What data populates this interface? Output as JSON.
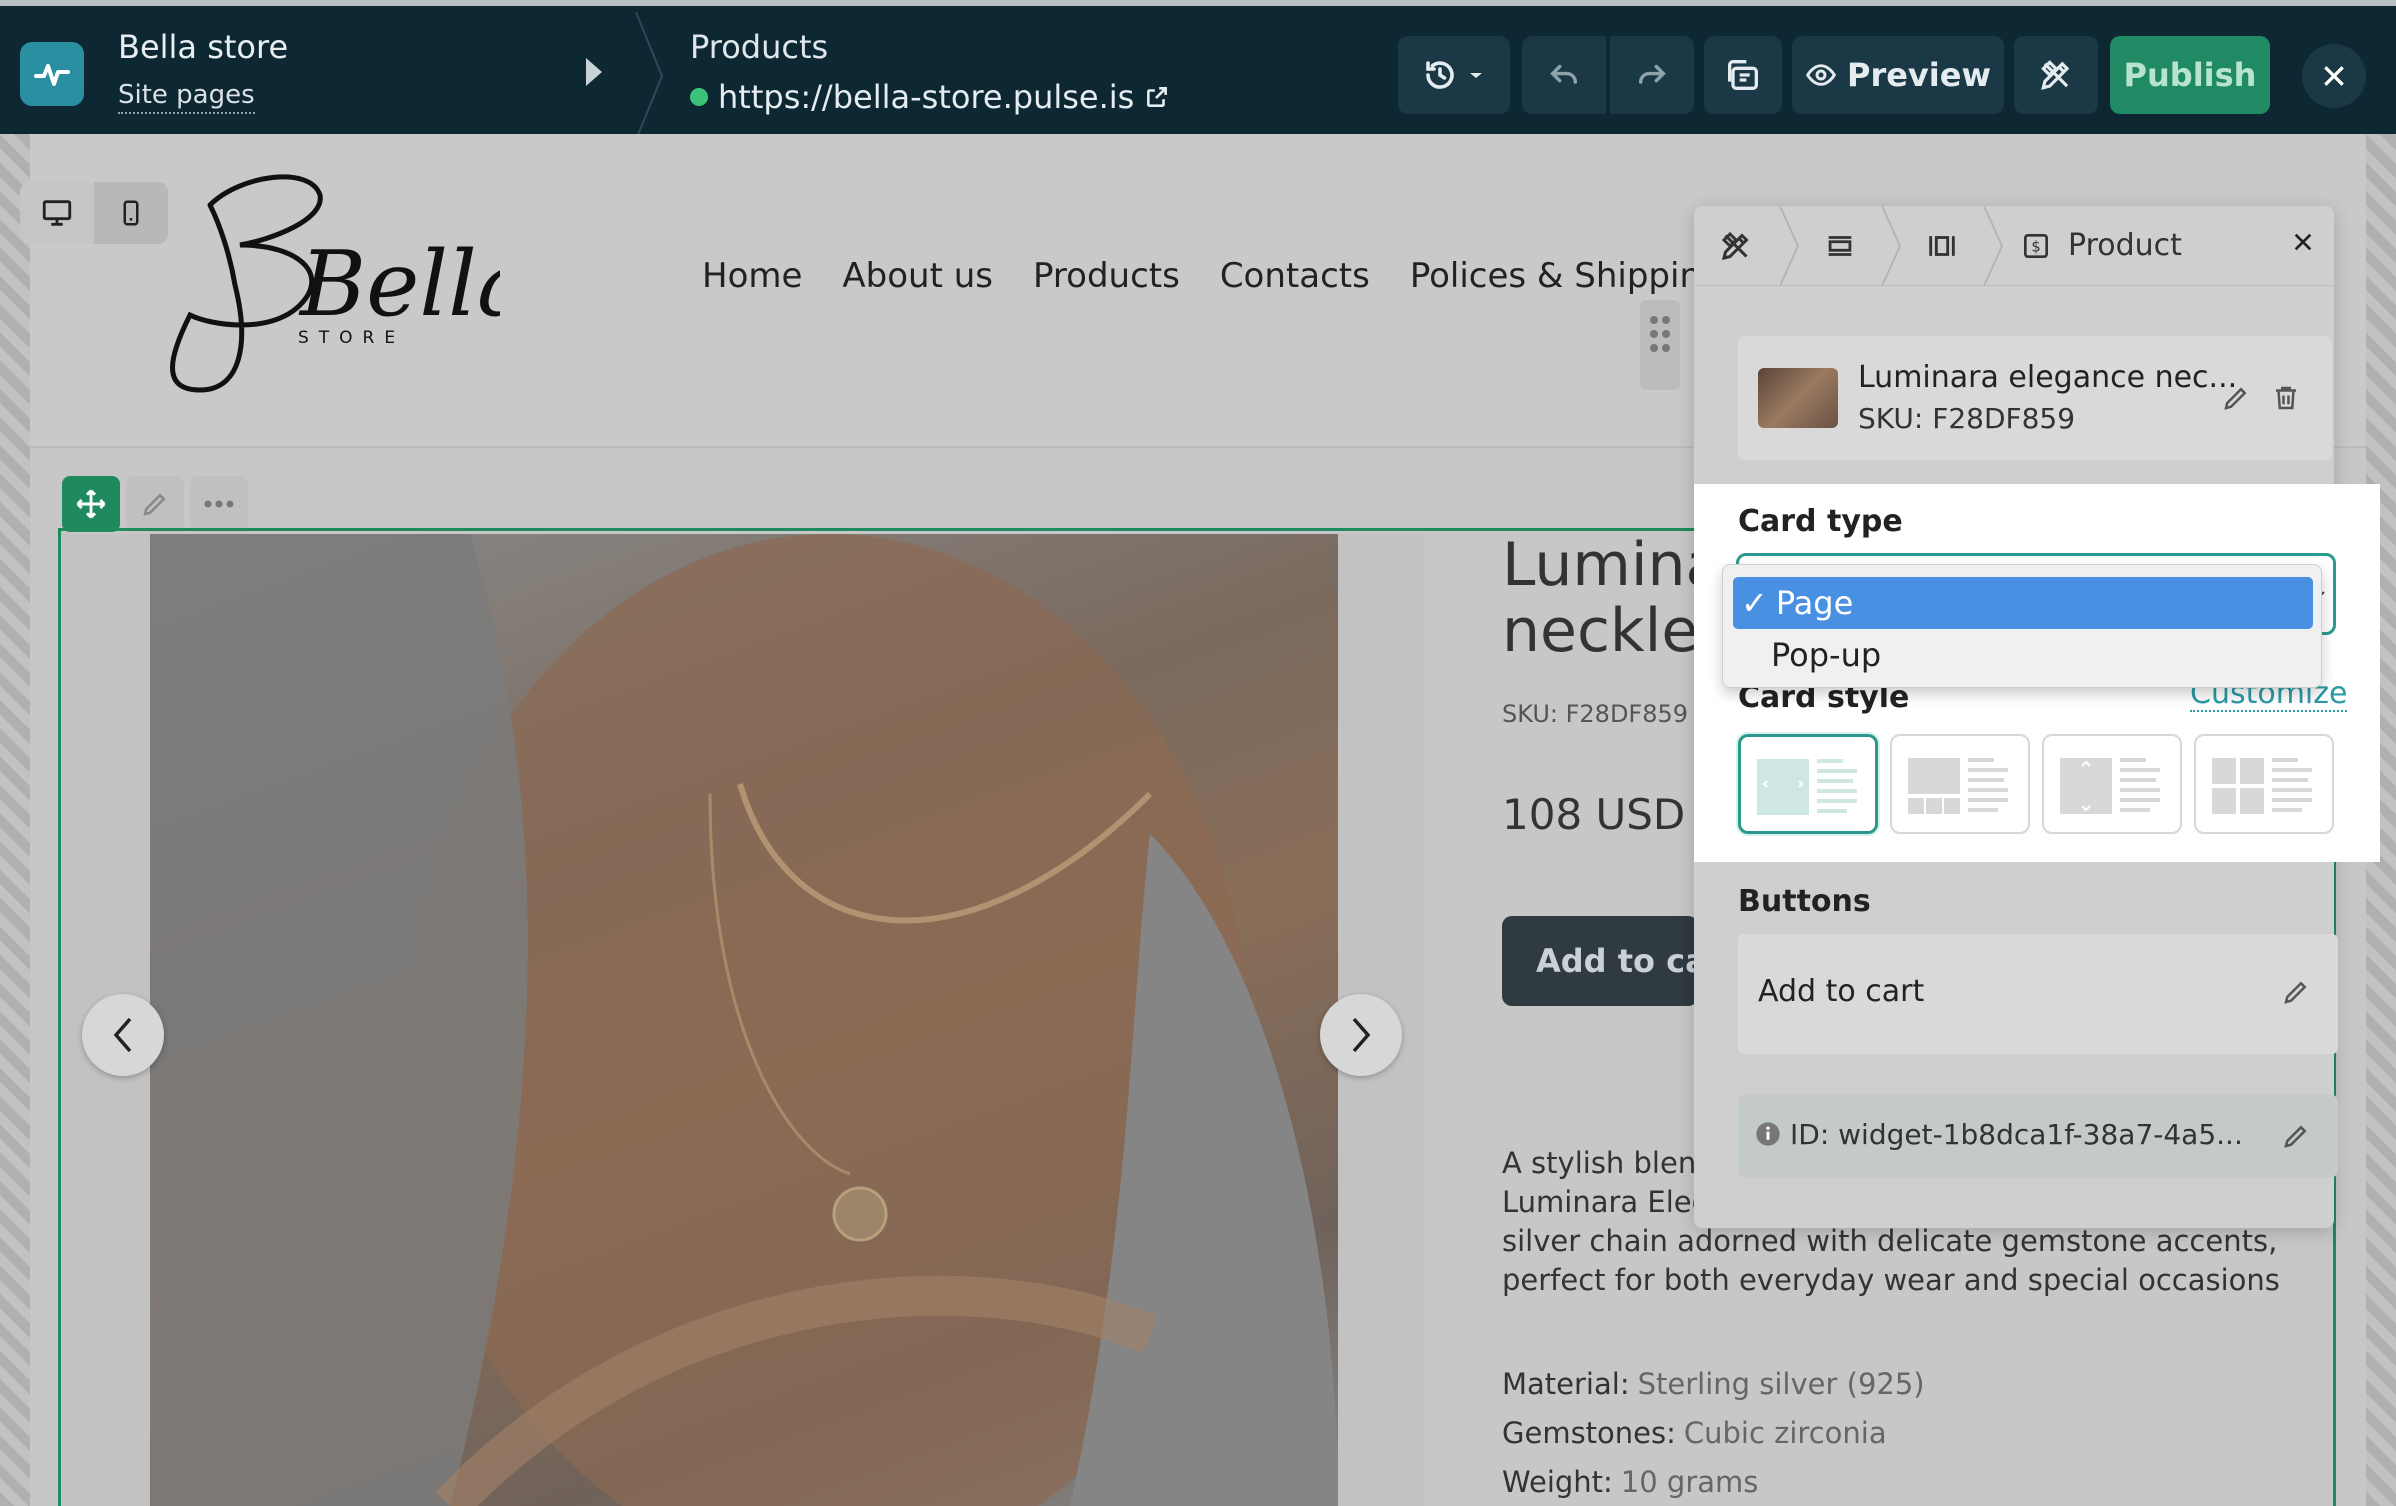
{
  "topbar": {
    "site_name": "Bella store",
    "site_pages_link": "Site pages",
    "page_name": "Products",
    "page_url": "https://bella-store.pulse.is",
    "preview_label": "Preview",
    "publish_label": "Publish"
  },
  "site": {
    "brand_script": "Bella",
    "brand_sub": "STORE",
    "nav": [
      "Home",
      "About us",
      "Products",
      "Contacts",
      "Polices & Shipping"
    ]
  },
  "product": {
    "title_line1": "Lumina",
    "title_line2": "neckles",
    "sku": "SKU: F28DF859",
    "price": "108 USD",
    "add_to_cart": "Add to car",
    "description": [
      "A stylish blend",
      "Luminara Eleg",
      "silver chain adorned with delicate gemstone accents,",
      "perfect for both everyday wear and special occasions."
    ],
    "specs": [
      {
        "label": "Material:",
        "value": "Sterling silver (925)"
      },
      {
        "label": "Gemstones:",
        "value": "Cubic zirconia"
      },
      {
        "label": "Weight:",
        "value": "10 grams"
      }
    ]
  },
  "panel": {
    "tab_label": "Product",
    "product_name": "Luminara elegance nec...",
    "product_sku": "SKU: F28DF859",
    "card_type_label": "Card type",
    "card_type_options": [
      "Page",
      "Pop-up"
    ],
    "card_type_selected": "Page",
    "card_style_label": "Card style",
    "customize_label": "Customize",
    "buttons_label": "Buttons",
    "button_item": "Add to cart",
    "widget_id": "ID: widget-1b8dca1f-38a7-4a5..."
  },
  "icons": {
    "logo": "pulse-icon",
    "history": "history-icon",
    "undo": "undo-icon",
    "redo": "redo-icon",
    "external": "external-link-icon"
  },
  "colors": {
    "topbar_bg": "#0d2733",
    "accent": "#1f8a63",
    "select_highlight": "#4a90e2",
    "link": "#2a9aa5"
  }
}
